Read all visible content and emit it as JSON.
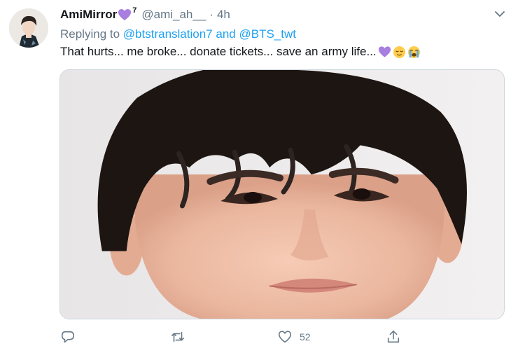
{
  "tweet": {
    "display_name": "AmiMirror",
    "name_superscript": "7",
    "handle": "@ami_ah__",
    "separator": "·",
    "time": "4h",
    "replying_prefix": "Replying to",
    "replying_mention_1": "@btstranslation7",
    "replying_and": "and",
    "replying_mention_2": "@BTS_twt",
    "text": "That hurts... me broke... donate tickets... save an army life...",
    "emojis": [
      "purple-heart",
      "relieved-face",
      "loudly-crying-face"
    ]
  },
  "actions": {
    "reply_count": "",
    "retweet_count": "",
    "like_count": "52",
    "share_count": ""
  },
  "colors": {
    "accent": "#1da1f2",
    "secondary_text": "#657786",
    "primary_text": "#14171a",
    "heart_purple": "#a87ee0"
  },
  "icons": {
    "caret": "chevron-down-icon",
    "reply": "reply-icon",
    "retweet": "retweet-icon",
    "like": "like-heart-icon",
    "share": "share-icon"
  }
}
